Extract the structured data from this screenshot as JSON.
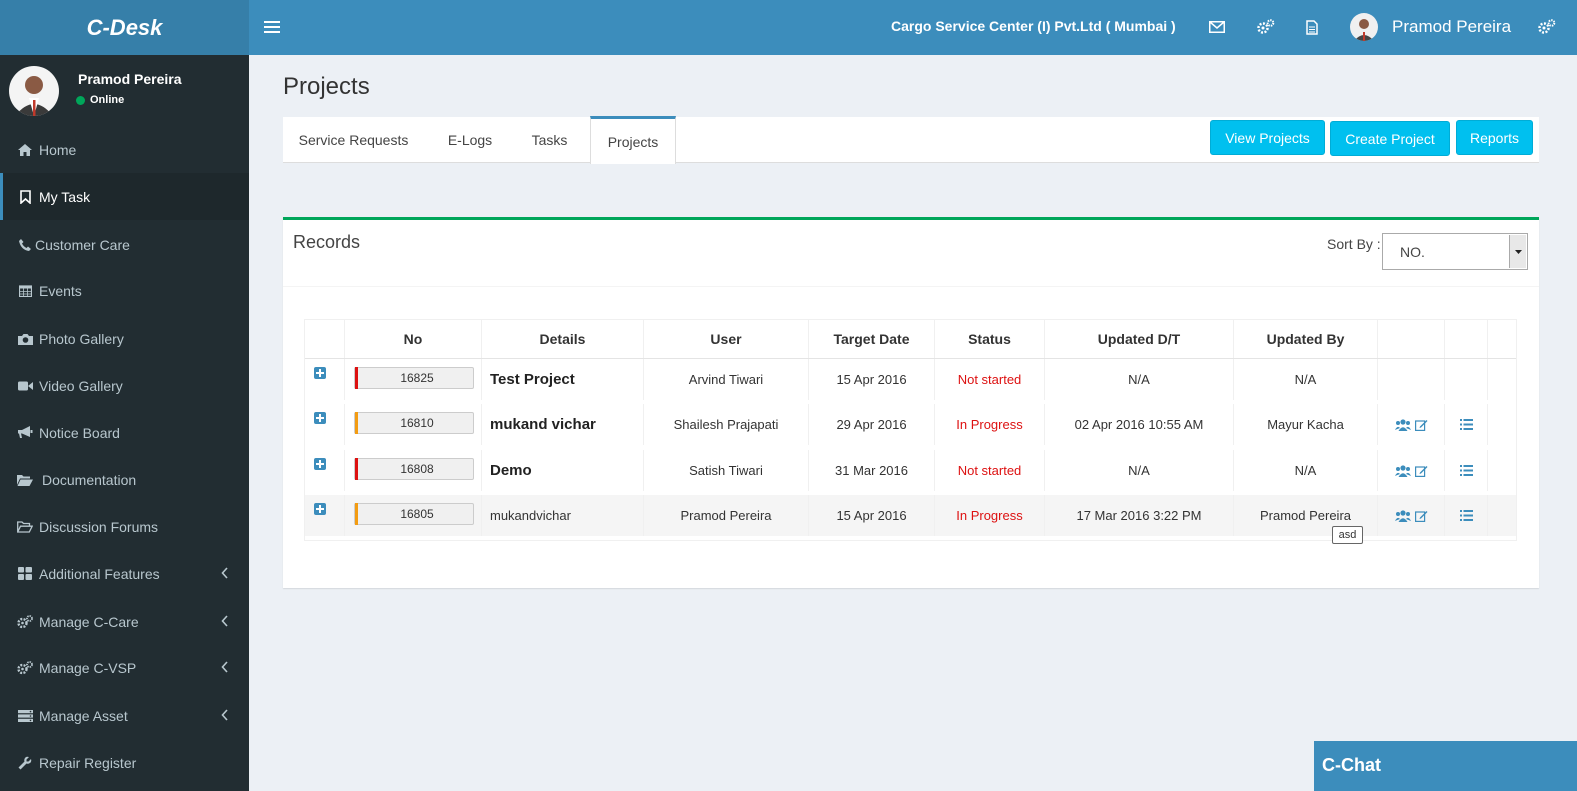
{
  "app": {
    "logo": "C-Desk"
  },
  "header": {
    "company": "Cargo Service Center (I) Pvt.Ltd ( Mumbai )",
    "user_name": "Pramod Pereira",
    "icons": [
      "menu-icon",
      "envelope-icon",
      "cogs-icon",
      "file-icon",
      "settings-icon"
    ]
  },
  "sidebar": {
    "user": {
      "name": "Pramod Pereira",
      "status": "Online",
      "status_color": "#00a65a"
    },
    "items": [
      {
        "label": "Home",
        "icon": "home-icon"
      },
      {
        "label": "My Task",
        "icon": "bookmark-icon",
        "active": true
      },
      {
        "label": "Customer Care",
        "icon": "phone-icon"
      },
      {
        "label": "Events",
        "icon": "calendar-icon"
      },
      {
        "label": "Photo Gallery",
        "icon": "camera-icon"
      },
      {
        "label": "Video Gallery",
        "icon": "video-camera-icon"
      },
      {
        "label": "Notice Board",
        "icon": "bullhorn-icon"
      },
      {
        "label": "Documentation",
        "icon": "folder-open-icon"
      },
      {
        "label": "Discussion Forums",
        "icon": "folder-open-outline-icon"
      },
      {
        "label": "Additional Features",
        "icon": "th-large-icon",
        "has_children": true
      },
      {
        "label": "Manage C-Care",
        "icon": "cogs-icon",
        "has_children": true
      },
      {
        "label": "Manage C-VSP",
        "icon": "cogs-icon",
        "has_children": true
      },
      {
        "label": "Manage Asset",
        "icon": "server-icon",
        "has_children": true
      },
      {
        "label": "Repair Register",
        "icon": "wrench-icon"
      }
    ]
  },
  "main": {
    "title": "Projects",
    "tabs": [
      {
        "label": "Service Requests"
      },
      {
        "label": "E-Logs"
      },
      {
        "label": "Tasks"
      },
      {
        "label": "Projects",
        "active": true
      }
    ],
    "buttons": {
      "view_projects": "View Projects",
      "create_project": "Create Project",
      "reports": "Reports"
    },
    "records": {
      "title": "Records",
      "sort_label": "Sort By :",
      "sort_value": "NO.",
      "columns": [
        "No",
        "Details",
        "User",
        "Target Date",
        "Status",
        "Updated D/T",
        "Updated By"
      ],
      "rows": [
        {
          "no": "16825",
          "priority_color": "#dd1111",
          "details": "Test Project",
          "details_bold": true,
          "user": "Arvind Tiwari",
          "target_date": "15 Apr 2016",
          "status": "Not started",
          "updated_dt": "N/A",
          "updated_by": "N/A",
          "actions": false
        },
        {
          "no": "16810",
          "priority_color": "#f39c12",
          "details": "mukand vichar",
          "details_bold": true,
          "user": "Shailesh Prajapati",
          "target_date": "29 Apr 2016",
          "status": "In Progress",
          "updated_dt": "02 Apr 2016 10:55 AM",
          "updated_by": "Mayur Kacha",
          "actions": true
        },
        {
          "no": "16808",
          "priority_color": "#dd1111",
          "details": "Demo",
          "details_bold": true,
          "user": "Satish Tiwari",
          "target_date": "31 Mar 2016",
          "status": "Not started",
          "updated_dt": "N/A",
          "updated_by": "N/A",
          "actions": true
        },
        {
          "no": "16805",
          "priority_color": "#f39c12",
          "details": "mukandvichar",
          "details_bold": false,
          "user": "Pramod Pereira",
          "target_date": "15 Apr 2016",
          "status": "In Progress",
          "updated_dt": "17 Mar 2016 3:22 PM",
          "updated_by": "Pramod Pereira",
          "actions": true
        }
      ],
      "tooltip": "asd"
    }
  },
  "chat": {
    "label": "C-Chat"
  },
  "colors": {
    "accent": "#3c8dbc",
    "sidebar_bg": "#222d32",
    "button": "#00c0ef",
    "status_text": "#dd1111",
    "box_border": "#00a65a"
  }
}
